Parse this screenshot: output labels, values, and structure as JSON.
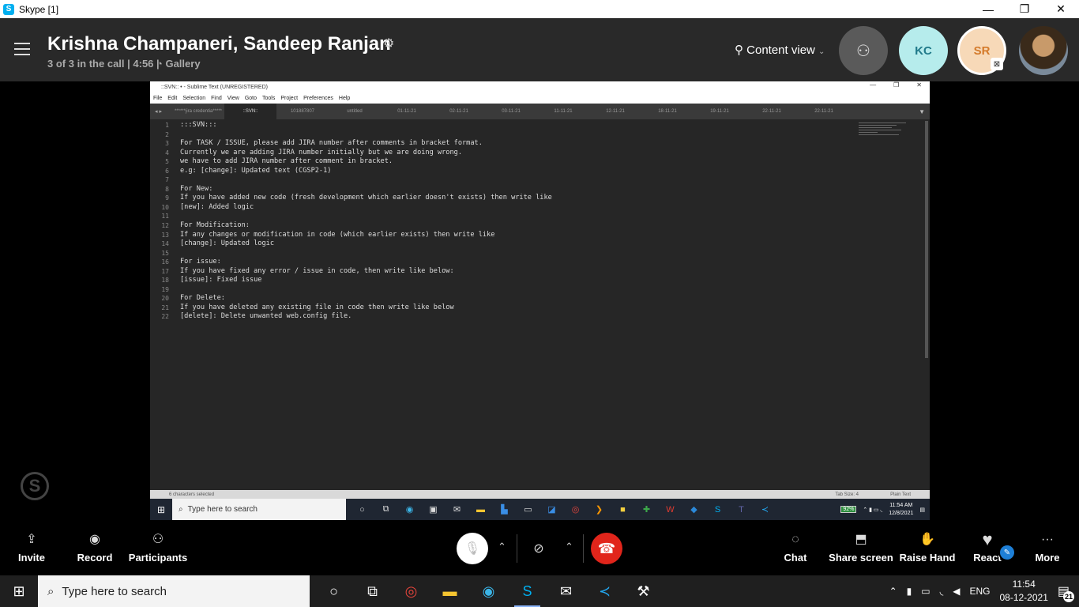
{
  "window": {
    "title": "Skype [1]",
    "controls": [
      "—",
      "❐",
      "✕"
    ]
  },
  "call": {
    "name": "Krishna Champaneri, Sandeep Ranjan",
    "subtitle": "3 of 3 in the call | 4:56 |",
    "gallery_label": "Gallery",
    "content_view_label": "Content view",
    "avatars": [
      {
        "initials": "KC"
      },
      {
        "initials": "SR"
      }
    ]
  },
  "sublime": {
    "title": "::SVN:: • - Sublime Text (UNREGISTERED)",
    "menu": [
      "File",
      "Edit",
      "Selection",
      "Find",
      "View",
      "Goto",
      "Tools",
      "Project",
      "Preferences",
      "Help"
    ],
    "tabs": [
      "******jira credentia*****",
      "::SVN::",
      "101887807",
      "untitled",
      "01-11-21",
      "02-11-21",
      "03-11-21",
      "11-11-21",
      "12-11-21",
      "18-11-21",
      "19-11-21",
      "22-11-21",
      "22-11-21"
    ],
    "active_tab_index": 1,
    "lines": [
      ":::SVN:::",
      "",
      "For TASK / ISSUE, please add JIRA number after comments in bracket format.",
      "Currently we are adding JIRA number initially but we are doing wrong.",
      "we have to add JIRA number after comment in bracket.",
      "e.g: [change]: Updated text (CGSP2-1)",
      "",
      "For New:",
      "If you have added new code (fresh development which earlier doesn't exists) then write like",
      "[new]: Added logic",
      "",
      "For Modification:",
      "If any changes or modification in code (which earlier exists) then write like",
      "[change]: Updated logic",
      "",
      "For issue:",
      "If you have fixed any error / issue in code, then write like below:",
      "[issue]: Fixed issue",
      "",
      "For Delete:",
      "If you have deleted any existing file in code then write like below",
      "[delete]: Delete unwanted web.config file."
    ],
    "line_numbers": [
      "1",
      "2",
      "3",
      "4",
      "5",
      "6",
      "7",
      "8",
      "9",
      "10",
      "11",
      "12",
      "13",
      "14",
      "15",
      "16",
      "17",
      "18",
      "19",
      "20",
      "21",
      "22"
    ],
    "status_left": "6 characters selected",
    "status_tab": "Tab Size: 4",
    "status_syntax": "Plain Text"
  },
  "inner_taskbar": {
    "search_placeholder": "Type here to search",
    "battery": "92%",
    "time": "11:54 AM",
    "date": "12/8/2021"
  },
  "controls": {
    "invite": "Invite",
    "record": "Record",
    "participants": "Participants",
    "chat": "Chat",
    "share_screen": "Share screen",
    "raise_hand": "Raise Hand",
    "react": "React",
    "more": "More"
  },
  "taskbar": {
    "search_placeholder": "Type here to search",
    "lang": "ENG",
    "time": "11:54",
    "date": "08-12-2021",
    "notifications": "21"
  },
  "colors": {
    "end_call": "#e1251b",
    "skype_blue": "#00aff0",
    "kc_avatar": "#b6ecec",
    "sr_avatar": "#f7d9b8"
  }
}
